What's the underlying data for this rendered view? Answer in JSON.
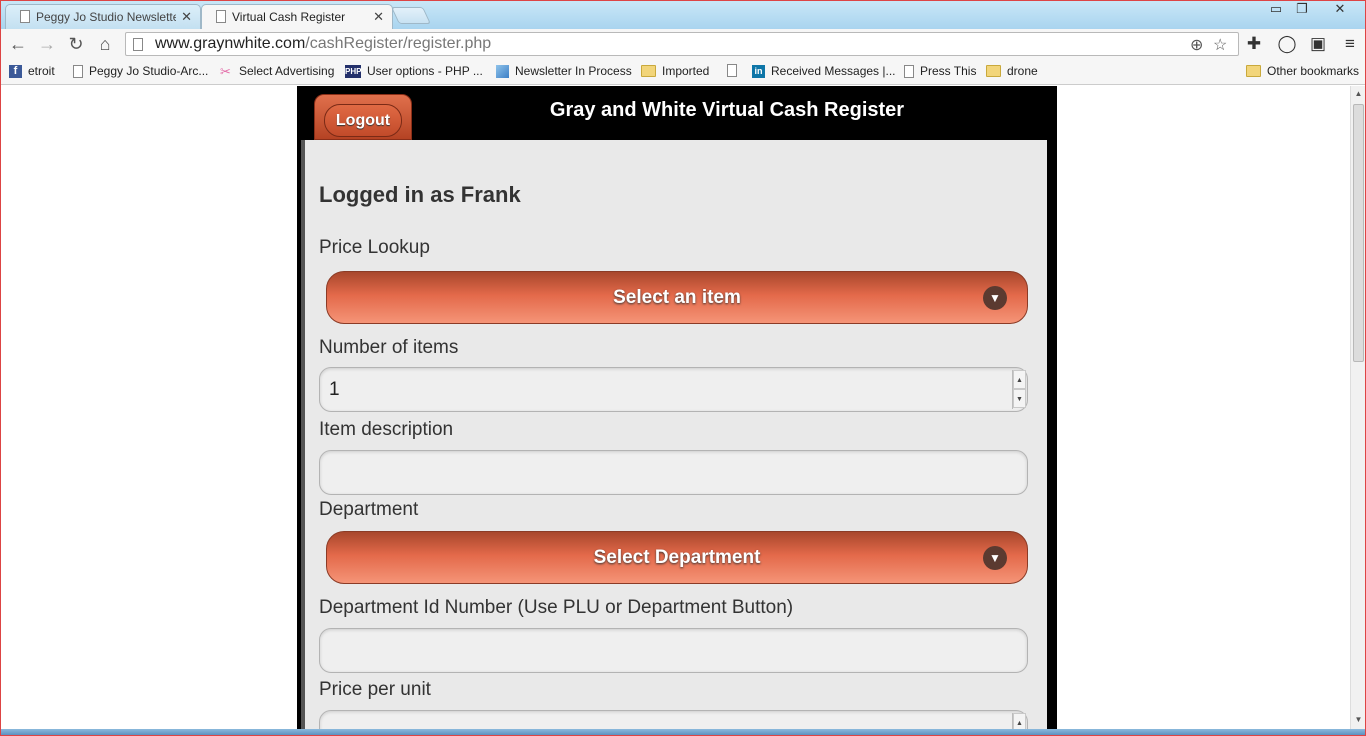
{
  "browser": {
    "tabs": [
      {
        "title": "Peggy Jo Studio Newslette",
        "active": false
      },
      {
        "title": "Virtual Cash Register",
        "active": true
      }
    ],
    "url_host": "www.graynwhite.com",
    "url_path": "/cashRegister/register.php",
    "bookmarks": [
      {
        "label": "etroit",
        "icon": "facebook-icon"
      },
      {
        "label": "Peggy Jo Studio-Arc...",
        "icon": "page-icon"
      },
      {
        "label": "Select Advertising",
        "icon": "ribbon-icon"
      },
      {
        "label": "User options - PHP ...",
        "icon": "php-icon"
      },
      {
        "label": "Newsletter In Process",
        "icon": "wave-icon"
      },
      {
        "label": "Imported",
        "icon": "folder-icon"
      },
      {
        "label": "",
        "icon": "page-icon"
      },
      {
        "label": "Received Messages |...",
        "icon": "linkedin-icon"
      },
      {
        "label": "Press This",
        "icon": "page-icon"
      },
      {
        "label": "drone",
        "icon": "folder-icon"
      }
    ],
    "other_bookmarks": "Other bookmarks"
  },
  "app": {
    "title": "Gray and White Virtual Cash Register",
    "logout_label": "Logout",
    "logged_in": "Logged in as Frank",
    "price_lookup_label": "Price Lookup",
    "select_item_label": "Select an item",
    "number_items_label": "Number of items",
    "number_items_value": "1",
    "item_description_label": "Item description",
    "item_description_value": "",
    "department_label": "Department",
    "select_department_label": "Select Department",
    "department_id_label": "Department Id Number (Use PLU or Department Button)",
    "department_id_value": "",
    "price_per_unit_label": "Price per unit",
    "price_per_unit_value": ""
  }
}
